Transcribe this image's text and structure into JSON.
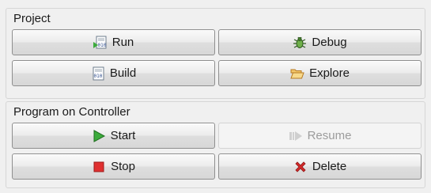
{
  "project": {
    "title": "Project",
    "run_label": "Run",
    "debug_label": "Debug",
    "build_label": "Build",
    "explore_label": "Explore"
  },
  "controller": {
    "title": "Program on Controller",
    "start_label": "Start",
    "resume_label": "Resume",
    "stop_label": "Stop",
    "delete_label": "Delete"
  },
  "icons": {
    "run": "run-binary-icon",
    "debug": "bug-icon",
    "build": "build-binary-icon",
    "explore": "open-folder-icon",
    "start": "play-icon",
    "resume": "resume-icon",
    "stop": "stop-icon",
    "delete": "delete-x-icon"
  },
  "colors": {
    "start_green": "#3cab3c",
    "stop_red": "#e03030",
    "delete_red": "#d42a2a",
    "folder_orange": "#e8a33c",
    "disabled_text": "#9c9c9c"
  },
  "state": {
    "resume_enabled": false
  }
}
